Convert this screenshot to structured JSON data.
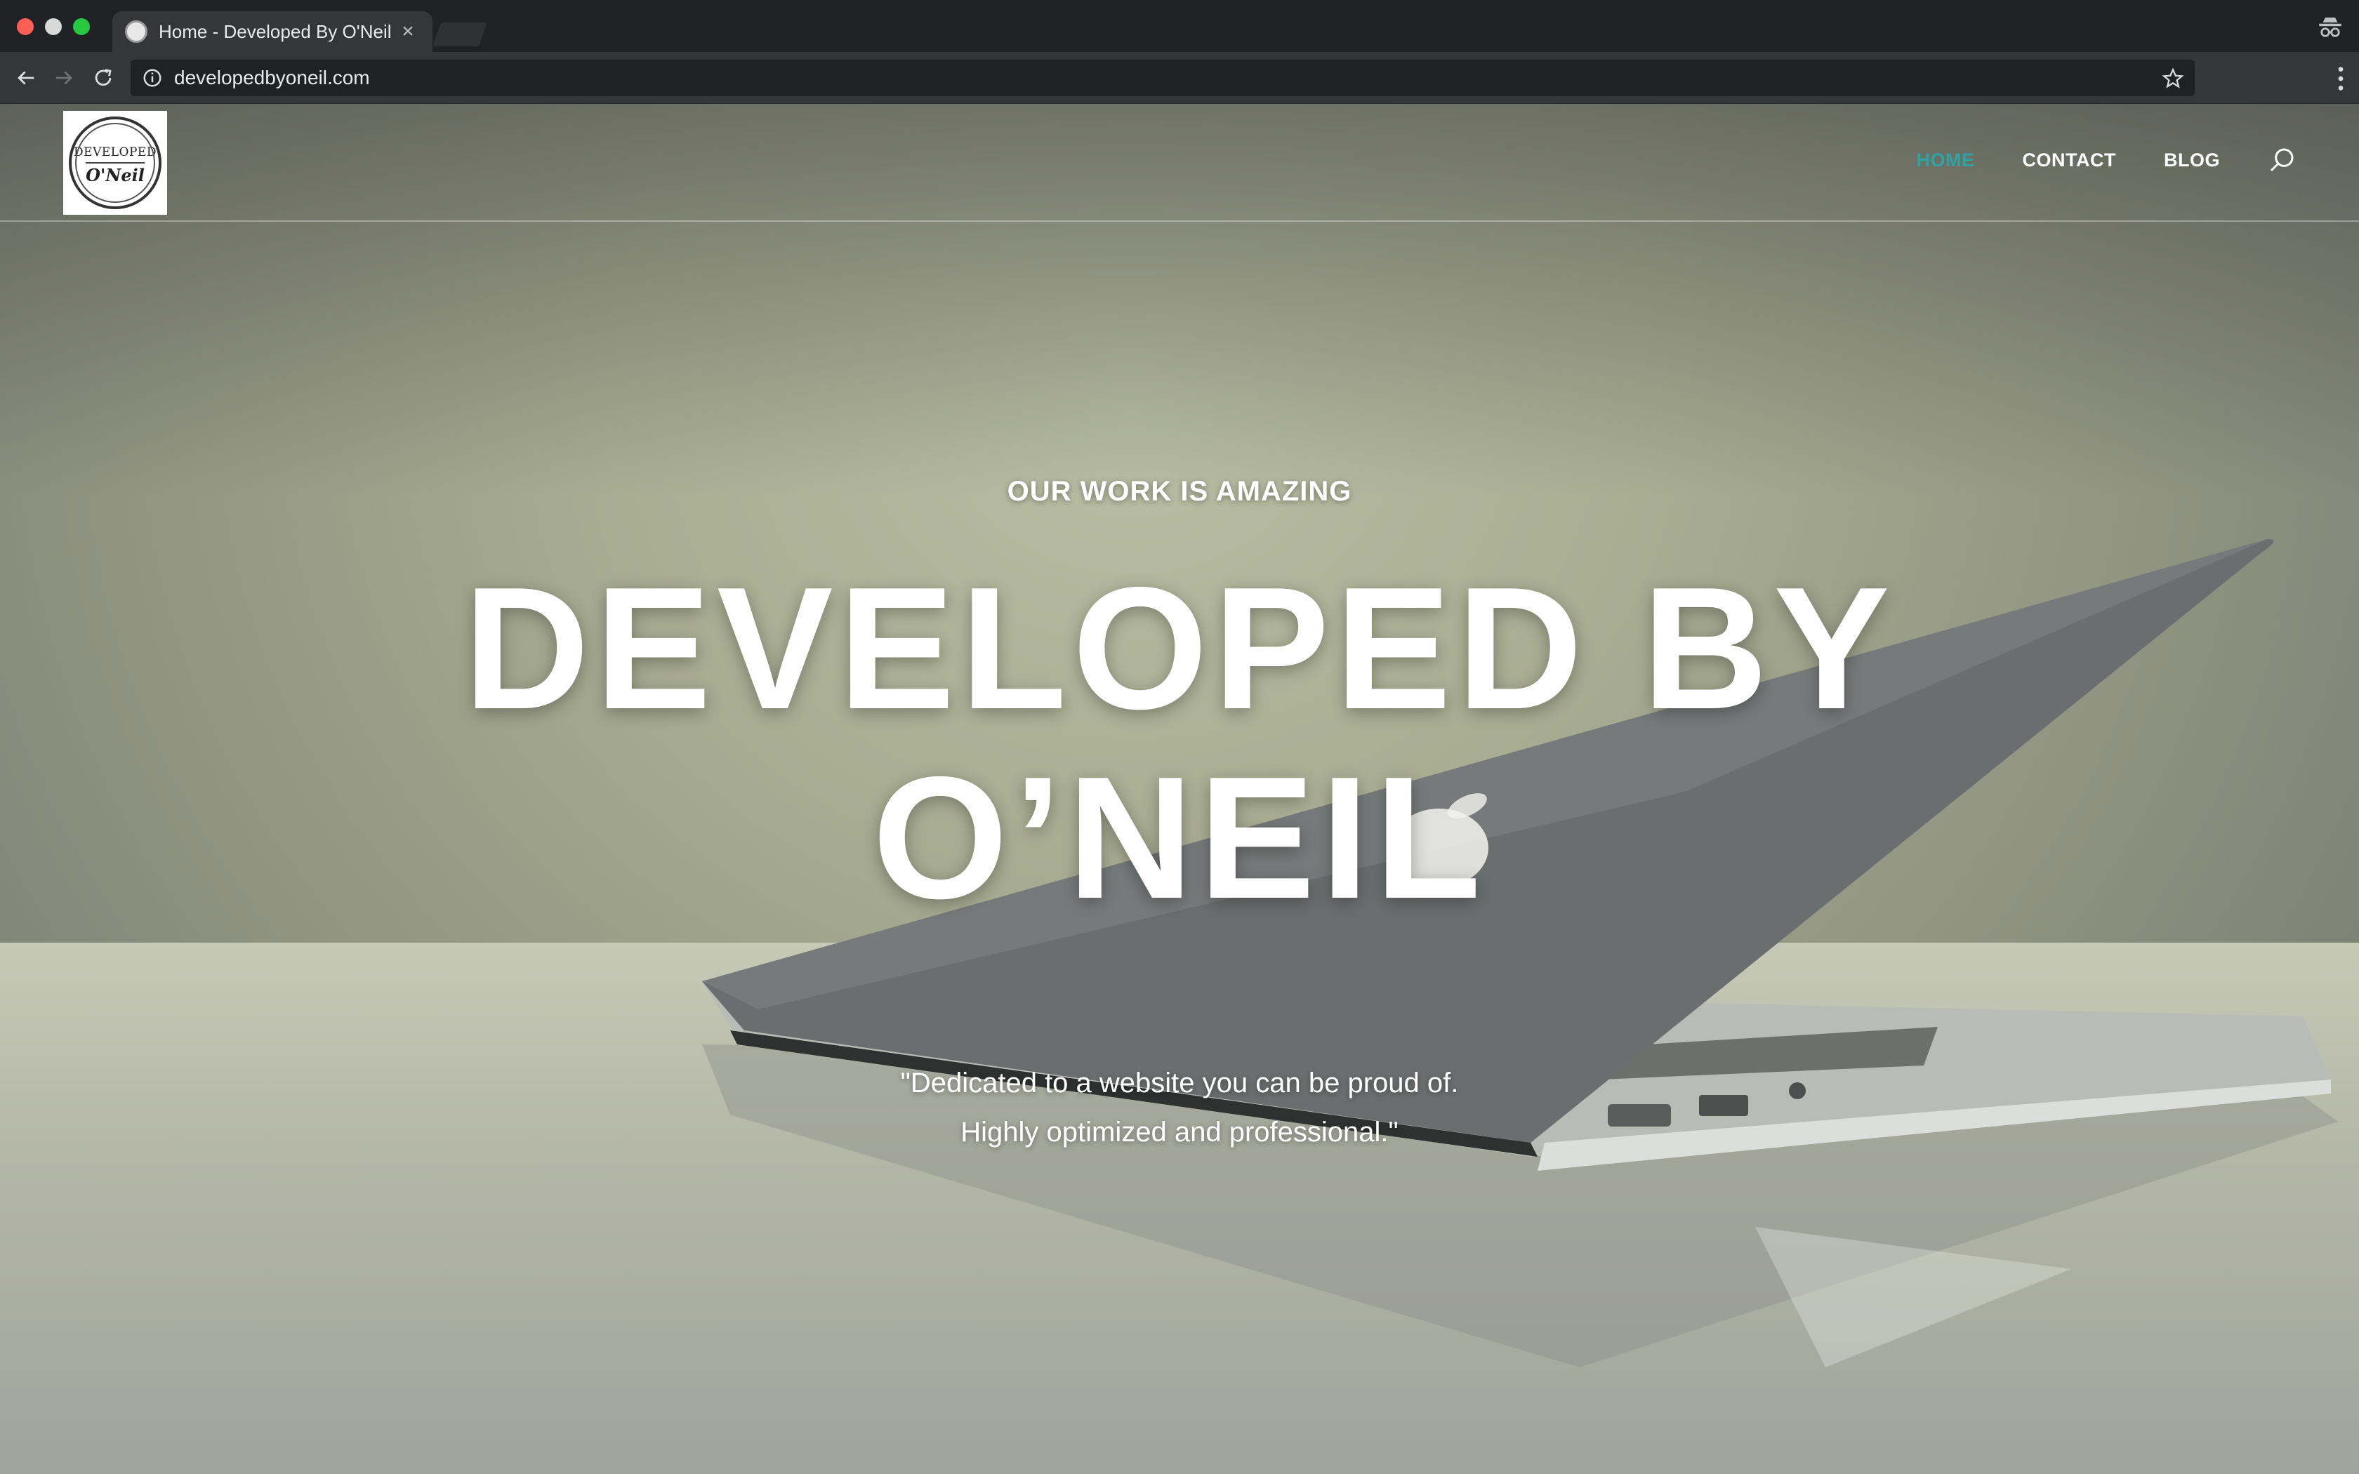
{
  "browser": {
    "tab_title": "Home - Developed By O'Neil",
    "tab_close": "×",
    "url": "developedbyoneil.com"
  },
  "site": {
    "logo_top": "DEVELOPED",
    "logo_bottom": "O'Neil",
    "nav": [
      "HOME",
      "CONTACT",
      "BLOG"
    ],
    "active_nav": "HOME",
    "accent_color": "#2ea3a3"
  },
  "hero": {
    "eyebrow": "OUR WORK IS AMAZING",
    "title_line1": "DEVELOPED BY",
    "title_line2": "O’NEIL",
    "quote_line1": "\"Dedicated to a website you can be proud of.",
    "quote_line2": "Highly optimized and professional.\""
  },
  "icons": [
    "back-icon",
    "forward-icon",
    "reload-icon",
    "info-icon",
    "star-icon",
    "menu-icon",
    "incognito-icon",
    "search-icon"
  ]
}
